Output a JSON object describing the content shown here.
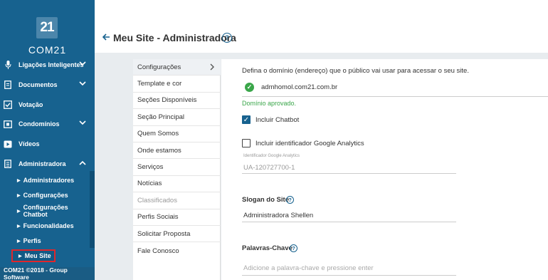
{
  "sidebar": {
    "logo_text": "21",
    "brand": "COM21",
    "items": [
      {
        "label": "Ligações Inteligentes",
        "icon": "microphone-icon",
        "chevron": true
      },
      {
        "label": "Documentos",
        "icon": "document-icon",
        "chevron": true
      },
      {
        "label": "Votação",
        "icon": "checkbox-icon",
        "chevron": false
      },
      {
        "label": "Condomínios",
        "icon": "building-icon",
        "chevron": true
      },
      {
        "label": "Vídeos",
        "icon": "video-icon",
        "chevron": false
      },
      {
        "label": "Administradora",
        "icon": "list-icon",
        "chevron": true
      }
    ],
    "sub_items": [
      {
        "label": "Administradores"
      },
      {
        "label": "Configurações"
      },
      {
        "label": "Configurações Chatbot"
      },
      {
        "label": "Funcionalidades"
      },
      {
        "label": "Perfis"
      }
    ],
    "active_sub_item": "Meu Site",
    "footer": "COM21 ©2018 - Group Software"
  },
  "header": {
    "title": "Meu Site - Administradora",
    "help": "?"
  },
  "menu": {
    "items": [
      {
        "label": "Configurações",
        "state": "active"
      },
      {
        "label": "Template e cor",
        "state": "normal"
      },
      {
        "label": "Seções Disponíveis",
        "state": "normal"
      },
      {
        "label": "Seção Principal",
        "state": "normal"
      },
      {
        "label": "Quem Somos",
        "state": "normal"
      },
      {
        "label": "Onde estamos",
        "state": "normal"
      },
      {
        "label": "Serviços",
        "state": "normal"
      },
      {
        "label": "Notícias",
        "state": "normal"
      },
      {
        "label": "Classificados",
        "state": "disabled"
      },
      {
        "label": "Perfis Sociais",
        "state": "normal"
      },
      {
        "label": "Solicitar Proposta",
        "state": "normal"
      },
      {
        "label": "Fale Conosco",
        "state": "normal"
      }
    ]
  },
  "content": {
    "domain_prompt": "Defina o domínio (endereço) que o público vai usar para acessar o seu site.",
    "domain_value": "admhomol.com21.com.br",
    "domain_status": "Domínio aprovado.",
    "chatbot_label": "Incluir Chatbot",
    "chatbot_checked": true,
    "analytics_label": "Incluir identificador Google Analytics",
    "analytics_checked": false,
    "analytics_field_label": "Identificador Google Analytics",
    "analytics_value": "UA-120727700-1",
    "slogan_label": "Slogan do Site",
    "slogan_value": "Administradora Shellen",
    "keywords_label": "Palavras-Chave",
    "keywords_placeholder": "Adicione a palavra-chave e pressione enter"
  },
  "colors": {
    "sidebar": "#17628f",
    "accent": "#17628f",
    "success": "#3aa64a",
    "highlight_border": "#e0262b"
  }
}
